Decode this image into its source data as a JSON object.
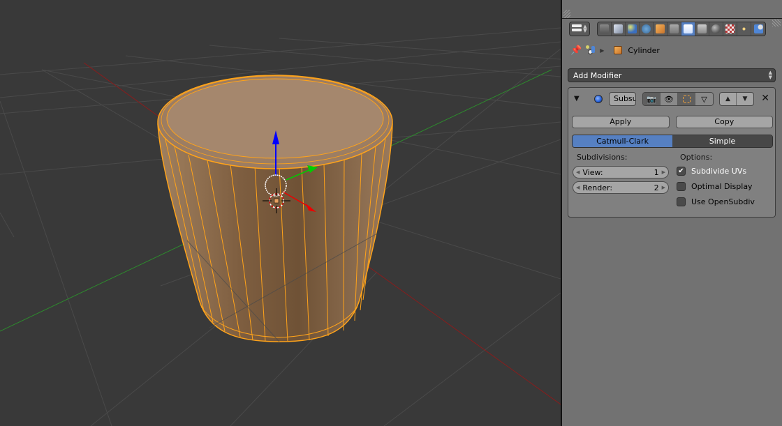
{
  "viewport": {
    "colors": {
      "background": "#393939",
      "grid": "#4a4a4a",
      "x_axis": "#8a1c1c",
      "y_axis": "#2d8a2d",
      "mesh_fill": "#9a7a5e",
      "wire_selected": "#ffa31a",
      "gizmo_z": "#0000ff",
      "gizmo_y": "#00cc00",
      "gizmo_x": "#ee0000"
    },
    "selected_object": "Cylinder"
  },
  "properties": {
    "context_tabs": [
      {
        "name": "render",
        "icon": "camera-icon",
        "active": false
      },
      {
        "name": "render-layers",
        "icon": "render-layers-icon",
        "active": false
      },
      {
        "name": "scene",
        "icon": "scene-icon",
        "active": false
      },
      {
        "name": "world",
        "icon": "world-icon",
        "active": false
      },
      {
        "name": "object",
        "icon": "object-cube-icon",
        "active": false
      },
      {
        "name": "constraints",
        "icon": "link-icon",
        "active": false
      },
      {
        "name": "modifiers",
        "icon": "wrench-icon",
        "active": true
      },
      {
        "name": "data",
        "icon": "mesh-data-icon",
        "active": false
      },
      {
        "name": "material",
        "icon": "material-sphere-icon",
        "active": false
      },
      {
        "name": "texture",
        "icon": "texture-checker-icon",
        "active": false
      },
      {
        "name": "particles",
        "icon": "particles-icon",
        "active": false
      },
      {
        "name": "physics",
        "icon": "physics-icon",
        "active": false
      }
    ],
    "breadcrumb": {
      "object_name": "Cylinder"
    },
    "add_modifier_label": "Add Modifier",
    "modifier": {
      "name": "Subsu",
      "apply_label": "Apply",
      "copy_label": "Copy",
      "types": [
        {
          "label": "Catmull-Clark",
          "active": true
        },
        {
          "label": "Simple",
          "active": false
        }
      ],
      "subdivisions_label": "Subdivisions:",
      "view_label": "View:",
      "view_value": "1",
      "render_label": "Render:",
      "render_value": "2",
      "options_label": "Options:",
      "options": [
        {
          "label": "Subdivide UVs",
          "checked": true
        },
        {
          "label": "Optimal Display",
          "checked": false
        },
        {
          "label": "Use OpenSubdiv",
          "checked": false
        }
      ]
    }
  }
}
